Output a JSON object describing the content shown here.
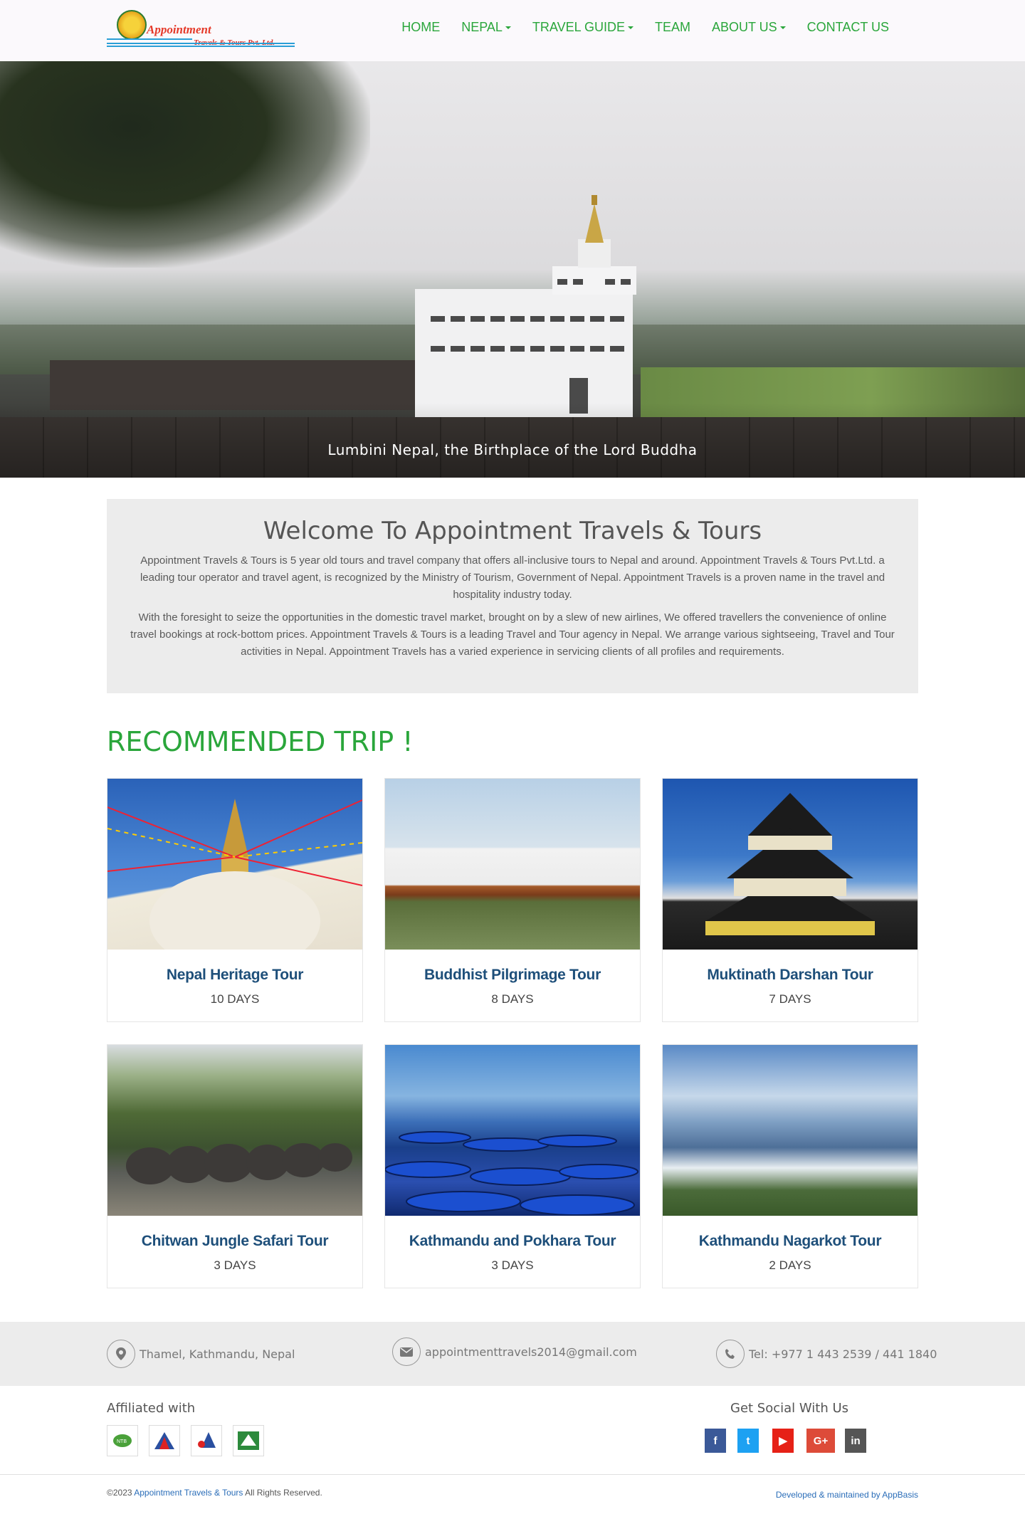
{
  "brand": {
    "logo_line1": "Appointment",
    "logo_line2": "Travels & Tours Pvt. Ltd."
  },
  "nav": [
    {
      "label": "HOME",
      "dropdown": false
    },
    {
      "label": "NEPAL",
      "dropdown": true
    },
    {
      "label": "TRAVEL GUIDE",
      "dropdown": true
    },
    {
      "label": "TEAM",
      "dropdown": false
    },
    {
      "label": "ABOUT US",
      "dropdown": true
    },
    {
      "label": "CONTACT US",
      "dropdown": false
    }
  ],
  "hero": {
    "caption": "Lumbini Nepal, the Birthplace of the Lord Buddha"
  },
  "welcome": {
    "title": "Welcome To Appointment Travels & Tours",
    "para1": "Appointment Travels & Tours is 5 year old tours and travel company that offers all-inclusive tours to Nepal and around. Appointment Travels & Tours Pvt.Ltd. a leading tour operator and travel agent, is recognized by the Ministry of Tourism, Government of Nepal. Appointment Travels is a proven name in the travel and hospitality industry today.",
    "para2": "With the foresight to seize the opportunities in the domestic travel market, brought on by a slew of new airlines, We offered travellers the convenience of online travel bookings at rock-bottom prices.  Appointment Travels & Tours is a leading Travel and Tour agency in Nepal. We arrange various sightseeing, Travel and Tour activities in Nepal. Appointment Travels has a varied experience in servicing clients of all profiles and requirements."
  },
  "recommended": {
    "title": "RECOMMENDED TRIP !",
    "trips": [
      {
        "title": "Nepal Heritage Tour",
        "days": "10 DAYS"
      },
      {
        "title": "Buddhist Pilgrimage Tour",
        "days": "8 DAYS"
      },
      {
        "title": "Muktinath Darshan Tour",
        "days": "7 DAYS"
      },
      {
        "title": "Chitwan Jungle Safari Tour",
        "days": "3 DAYS"
      },
      {
        "title": "Kathmandu and Pokhara Tour",
        "days": "3 DAYS"
      },
      {
        "title": "Kathmandu Nagarkot Tour",
        "days": "2 DAYS"
      }
    ]
  },
  "contact": {
    "address": "Thamel, Kathmandu, Nepal",
    "email": "appointmenttravels2014@gmail.com",
    "phone": "Tel: +977 1 443 2539 / 441 1840"
  },
  "footer": {
    "affiliated_title": "Affiliated with",
    "affiliations": [
      "NTB-icon",
      "NMA-icon",
      "TAAN-icon",
      "KEEP-icon"
    ],
    "social_title": "Get Social With Us",
    "social": [
      {
        "label": "f",
        "icon": "facebook-icon",
        "color": "#3b5998"
      },
      {
        "label": "t",
        "icon": "twitter-icon",
        "color": "#1da1f2"
      },
      {
        "label": "▶",
        "icon": "youtube-icon",
        "color": "#e62117"
      },
      {
        "label": "G+",
        "icon": "google-plus-icon",
        "color": "#dd4b39"
      },
      {
        "label": "in",
        "icon": "linkedin-icon",
        "color": "#555555"
      }
    ],
    "copyright_prefix": "©2023",
    "copyright_link": "Appointment Travels & Tours",
    "copyright_suffix": "All Rights Reserved.",
    "developer": "Developed & maintained by AppBasis"
  },
  "colors": {
    "accent_green": "#2aa63b",
    "trip_title_blue": "#1e4f7a",
    "link_blue": "#2a6db8"
  }
}
